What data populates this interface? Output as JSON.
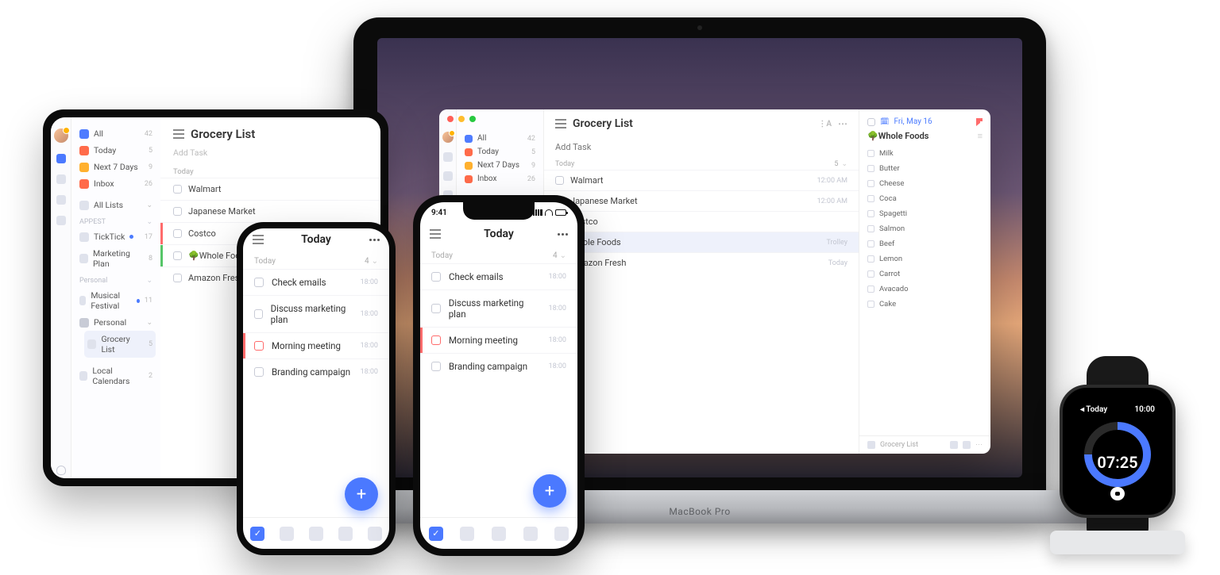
{
  "mac": {
    "sidebar": {
      "smart": [
        {
          "label": "All",
          "count": 42
        },
        {
          "label": "Today",
          "count": 5
        },
        {
          "label": "Next 7 Days",
          "count": 9
        },
        {
          "label": "Inbox",
          "count": 26
        }
      ]
    },
    "main": {
      "title": "Grocery List",
      "add_placeholder": "Add Task",
      "section": "Today",
      "section_count": "5",
      "tasks": [
        {
          "label": "Walmart",
          "time": "12:00 AM"
        },
        {
          "label": "Japanese Market",
          "time": "12:00 AM"
        },
        {
          "label": "Costco",
          "time": ""
        },
        {
          "label": "Whole Foods",
          "time": "Trolley",
          "sel": true
        },
        {
          "label": "Amazon Fresh",
          "time": "Today"
        }
      ]
    },
    "detail": {
      "date": "Fri, May 16",
      "title": "🌳Whole Foods",
      "items": [
        "Milk",
        "Butter",
        "Cheese",
        "Coca",
        "Spagetti",
        "Salmon",
        "Beef",
        "Lemon",
        "Carrot",
        "Avacado",
        "Cake"
      ],
      "footer": "Grocery List"
    }
  },
  "ipad": {
    "smart": [
      {
        "label": "All",
        "count": 42
      },
      {
        "label": "Today",
        "count": 5
      },
      {
        "label": "Next 7 Days",
        "count": 9
      },
      {
        "label": "Inbox",
        "count": 26
      }
    ],
    "all_lists": "All Lists",
    "sections": {
      "appest": {
        "label": "APPEST",
        "items": [
          {
            "label": "TickTick",
            "count": 17,
            "dot": true
          },
          {
            "label": "Marketing Plan",
            "count": 8
          }
        ]
      },
      "personal": {
        "label": "Personal",
        "items": [
          {
            "label": "Musical Festival",
            "count": 11,
            "dot": true
          },
          {
            "label": "Personal"
          },
          {
            "label": "Grocery List",
            "count": 5,
            "sel": true
          }
        ]
      }
    },
    "local_cal": {
      "label": "Local Calendars",
      "count": 2
    },
    "main": {
      "title": "Grocery List",
      "add_placeholder": "Add Task",
      "section": "Today",
      "tasks": [
        {
          "label": "Walmart"
        },
        {
          "label": "Japanese Market"
        },
        {
          "label": "Costco",
          "red": true
        },
        {
          "label": "🌳Whole Foods",
          "green": true
        },
        {
          "label": "Amazon Fresh"
        }
      ]
    }
  },
  "phone": {
    "title": "Today",
    "section": "Today",
    "count": "4",
    "tasks": [
      {
        "label": "Check emails",
        "time": "18:00"
      },
      {
        "label": "Discuss marketing plan",
        "time": "18:00"
      },
      {
        "label": "Morning meeting",
        "time": "18:00",
        "hp": true
      },
      {
        "label": "Branding campaign",
        "time": "18:00"
      }
    ],
    "status_time": "9:41"
  },
  "watch": {
    "back": "Today",
    "clock": "10:00",
    "timer": "07:25"
  }
}
